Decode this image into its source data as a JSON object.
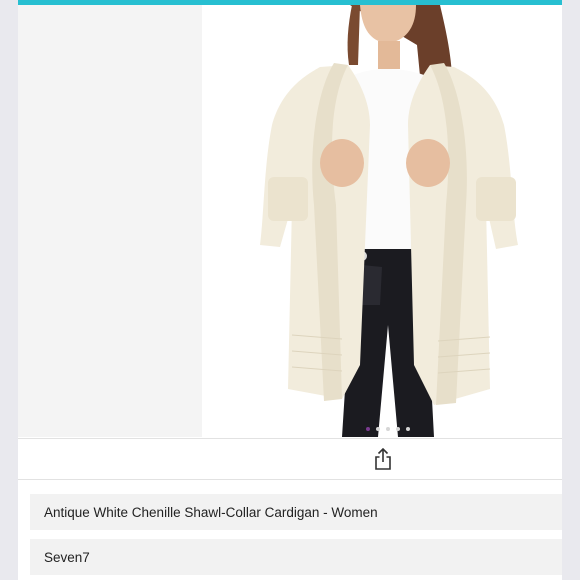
{
  "colors": {
    "accent_bar": "#27bfd1",
    "active_dot": "#7a3b8f"
  },
  "gallery": {
    "image_alt": "Woman wearing an antique white chenille shawl-collar cardigan over a white tee and black jeans",
    "slide_count": 5,
    "active_slide": 1
  },
  "actions": {
    "share_icon": "share-icon"
  },
  "product": {
    "title": "Antique White Chenille Shawl-Collar Cardigan - Women",
    "brand": "Seven7"
  }
}
